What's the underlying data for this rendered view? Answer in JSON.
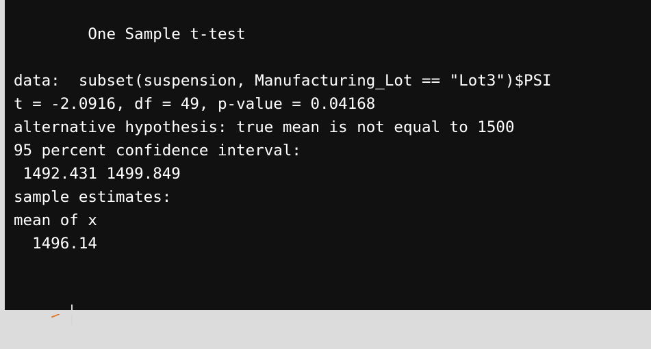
{
  "console": {
    "lines": [
      "        One Sample t-test",
      "",
      "data:  subset(suspension, Manufacturing_Lot == \"Lot3\")$PSI",
      "t = -2.0916, df = 49, p-value = 0.04168",
      "alternative hypothesis: true mean is not equal to 1500",
      "95 percent confidence interval:",
      " 1492.431 1499.849",
      "sample estimates:",
      "mean of x",
      "  1496.14"
    ],
    "prompt": ">"
  },
  "colors": {
    "background": "#111111",
    "text": "#ffffff",
    "prompt": "#e8721c"
  }
}
